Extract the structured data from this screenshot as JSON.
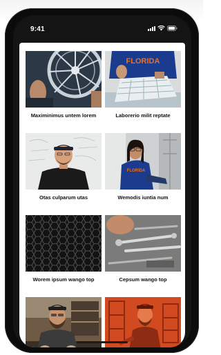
{
  "status_bar": {
    "time": "9:41",
    "icons": [
      "signal-icon",
      "wifi-icon",
      "battery-icon"
    ]
  },
  "grid": {
    "items": [
      {
        "caption": "Maximinimus untem lorem",
        "image": "wheel-photo"
      },
      {
        "caption": "Laborerio milit reptate",
        "image": "florida-student-photo"
      },
      {
        "caption": "Otas culparum utas",
        "image": "man-whiteboard-photo"
      },
      {
        "caption": "Wemodis iuntia num",
        "image": "woman-florida-photo"
      },
      {
        "caption": "Worem ipsum wango top",
        "image": "honeycomb-photo"
      },
      {
        "caption": "Cepsum wango top",
        "image": "tools-photo"
      },
      {
        "caption": "",
        "image": "workshop-man-photo"
      },
      {
        "caption": "",
        "image": "orange-lab-photo"
      }
    ]
  },
  "colors": {
    "florida_orange": "#e8702a",
    "florida_blue": "#1b3b8f",
    "phone_frame": "#0b0b0b"
  }
}
